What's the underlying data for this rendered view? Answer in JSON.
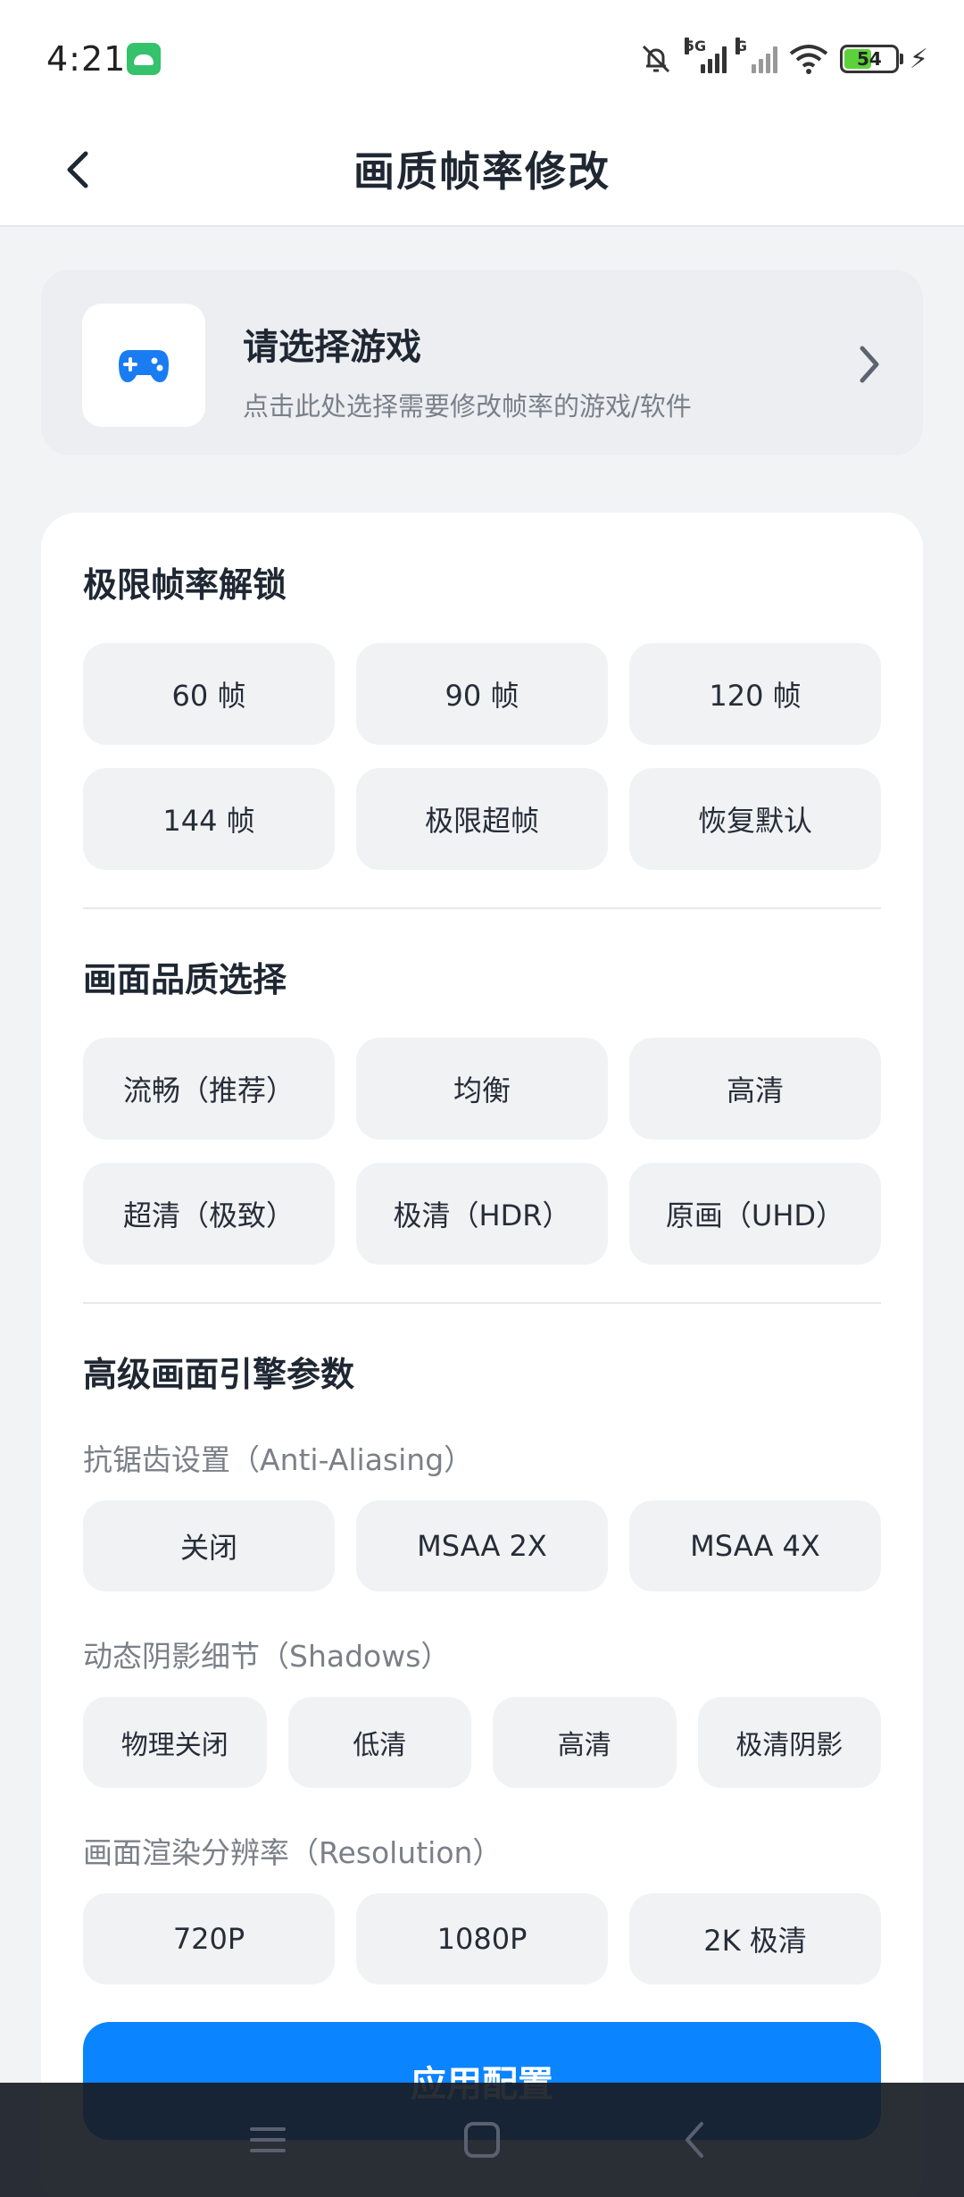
{
  "status_bar": {
    "time": "4:21",
    "network_5g": "5G",
    "network_g": "G",
    "battery": "54"
  },
  "header": {
    "title": "画质帧率修改"
  },
  "game_select": {
    "title": "请选择游戏",
    "subtitle": "点击此处选择需要修改帧率的游戏/软件"
  },
  "frame_rate": {
    "title": "极限帧率解锁",
    "options": [
      "60 帧",
      "90 帧",
      "120 帧",
      "144 帧",
      "极限超帧",
      "恢复默认"
    ]
  },
  "quality": {
    "title": "画面品质选择",
    "options": [
      "流畅（推荐）",
      "均衡",
      "高清",
      "超清（极致）",
      "极清（HDR）",
      "原画（UHD）"
    ]
  },
  "advanced": {
    "title": "高级画面引擎参数",
    "anti_aliasing": {
      "label": "抗锯齿设置（Anti-Aliasing）",
      "options": [
        "关闭",
        "MSAA 2X",
        "MSAA 4X"
      ]
    },
    "shadows": {
      "label": "动态阴影细节（Shadows）",
      "options": [
        "物理关闭",
        "低清",
        "高清",
        "极清阴影"
      ]
    },
    "resolution": {
      "label": "画面渲染分辨率（Resolution）",
      "options": [
        "720P",
        "1080P",
        "2K 极清"
      ]
    }
  },
  "apply_button": "应用配置",
  "colors": {
    "accent": "#0a84ff",
    "background": "#f2f3f5",
    "option_bg": "#f1f2f4"
  },
  "icons": [
    "gamepad-icon",
    "back-arrow-icon",
    "chevron-right-icon",
    "menu-icon",
    "home-icon",
    "nav-back-icon"
  ]
}
